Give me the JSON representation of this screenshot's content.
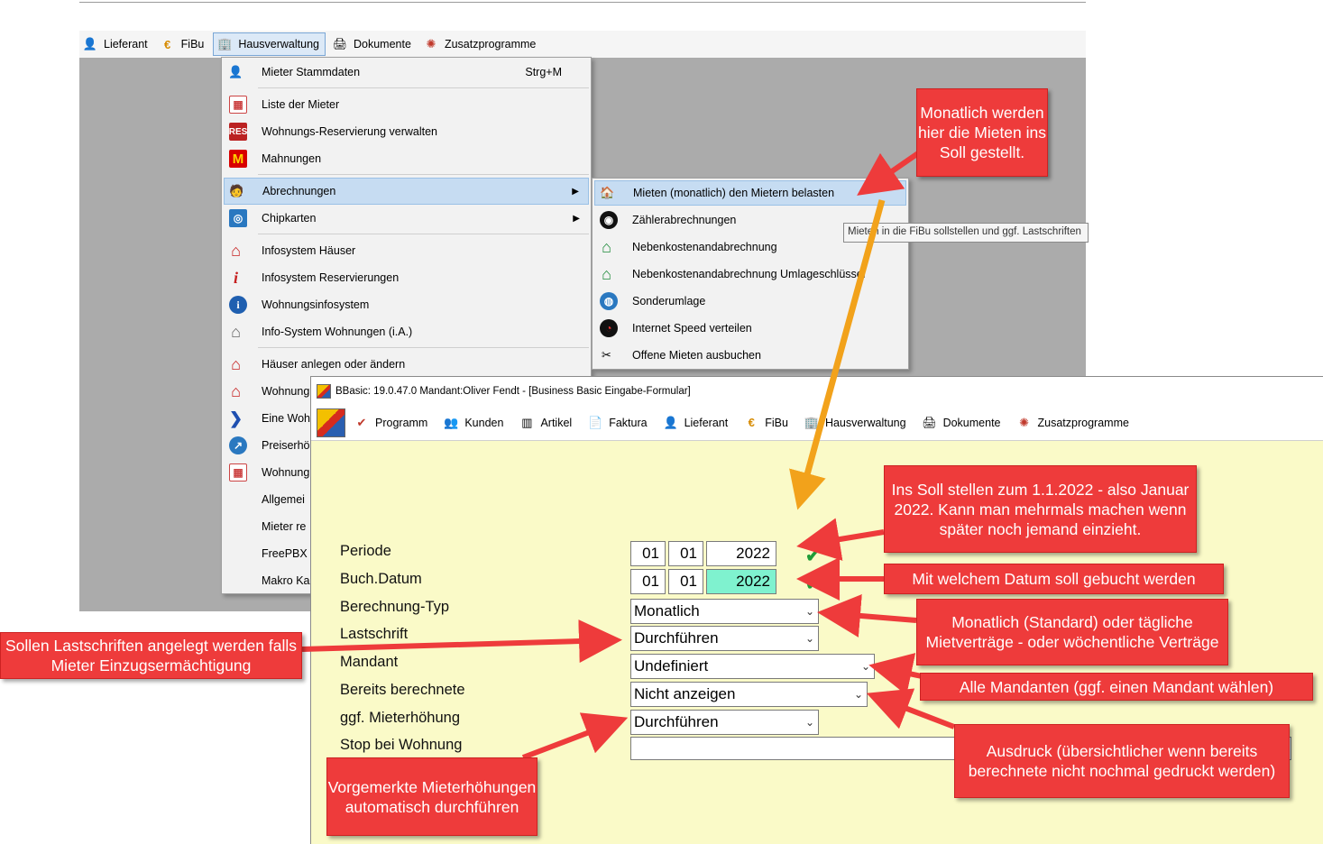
{
  "bg_menubar": {
    "items": [
      {
        "label": "Lieferant",
        "icon": "person-icon"
      },
      {
        "label": "FiBu",
        "icon": "euro-icon"
      },
      {
        "label": "Hausverwaltung",
        "icon": "house-icon"
      },
      {
        "label": "Dokumente",
        "icon": "printer-icon"
      },
      {
        "label": "Zusatzprogramme",
        "icon": "gear-colorful-icon"
      }
    ]
  },
  "menu": {
    "items": [
      {
        "label": "Mieter Stammdaten",
        "shortcut": "Strg+M"
      },
      {
        "label": "Liste der Mieter"
      },
      {
        "label": "Wohnungs-Reservierung verwalten"
      },
      {
        "label": "Mahnungen"
      },
      {
        "label": "Abrechnungen"
      },
      {
        "label": "Chipkarten"
      },
      {
        "label": "Infosystem Häuser"
      },
      {
        "label": "Infosystem Reservierungen"
      },
      {
        "label": "Wohnungsinfosystem"
      },
      {
        "label": "Info-System Wohnungen (i.A.)"
      },
      {
        "label": "Häuser anlegen oder ändern"
      },
      {
        "label": "Wohnung"
      },
      {
        "label": "Eine Woh"
      },
      {
        "label": "Preiserhö"
      },
      {
        "label": "Wohnung"
      },
      {
        "label": "Allgemei"
      },
      {
        "label": "Mieter re"
      },
      {
        "label": "FreePBX E"
      },
      {
        "label": "Makro Ka"
      }
    ]
  },
  "submenu": {
    "items": [
      {
        "label": "Mieten (monatlich) den Mietern belasten"
      },
      {
        "label": "Zählerabrechnungen"
      },
      {
        "label": "Nebenkostenandabrechnung"
      },
      {
        "label": "Nebenkostenandabrechnung Umlageschlüssel"
      },
      {
        "label": "Sonderumlage"
      },
      {
        "label": "Internet Speed verteilen"
      },
      {
        "label": "Offene Mieten ausbuchen"
      }
    ]
  },
  "tooltip": "Mieten in die FiBu sollstellen und ggf. Lastschriften",
  "window": {
    "title": "BBasic: 19.0.47.0 Mandant:Oliver Fendt  - [Business Basic Eingabe-Formular]",
    "menu": [
      {
        "label": "Programm",
        "icon": "check-circle-icon"
      },
      {
        "label": "Kunden",
        "icon": "people-icon"
      },
      {
        "label": "Artikel",
        "icon": "barcode-icon"
      },
      {
        "label": "Faktura",
        "icon": "document-icon"
      },
      {
        "label": "Lieferant",
        "icon": "person-icon"
      },
      {
        "label": "FiBu",
        "icon": "euro-icon"
      },
      {
        "label": "Hausverwaltung",
        "icon": "house-icon"
      },
      {
        "label": "Dokumente",
        "icon": "printer-icon"
      },
      {
        "label": "Zusatzprogramme",
        "icon": "gear-colorful-icon"
      }
    ]
  },
  "form": {
    "labels": [
      "Periode",
      "Buch.Datum",
      "Berechnung-Typ",
      "Lastschrift",
      "Mandant",
      "Bereits berechnete",
      "ggf. Mieterhöhung",
      "Stop bei Wohnung"
    ],
    "periode": {
      "day": "01",
      "month": "01",
      "year": "2022"
    },
    "buchdatum": {
      "day": "01",
      "month": "01",
      "year": "2022"
    },
    "berechnung_typ": "Monatlich",
    "lastschrift": "Durchführen",
    "mandant": "Undefiniert",
    "bereits": "Nicht anzeigen",
    "mieterhoehung": "Durchführen",
    "stop_bei_wohnung": ""
  },
  "callouts": {
    "monatlich": "Monatlich werden hier die Mieten ins Soll gestellt.",
    "soll": "Ins Soll stellen zum 1.1.2022 - also Januar 2022. Kann man mehrmals machen wenn später noch jemand einzieht.",
    "datum": "Mit welchem Datum soll gebucht werden",
    "typ": "Monatlich (Standard) oder tägliche Mietverträge - oder wöchentliche Verträge",
    "lastschrift": "Sollen Lastschriften angelegt werden falls Mieter Einzugsermächtigung",
    "mandant": "Alle Mandanten (ggf. einen Mandant wählen)",
    "ausdruck": "Ausdruck (übersichtlicher wenn bereits berechnete nicht nochmal gedruckt werden)",
    "erhoehung": "Vorgemerkte Mieterhöhungen automatisch durchführen"
  },
  "colors": {
    "callout": "#ee3b3b",
    "form_bg": "#fafac8",
    "highlight": "#c6dcf2",
    "arrow_orange": "#f2a21b",
    "date_highlight": "#7ff2cf"
  }
}
